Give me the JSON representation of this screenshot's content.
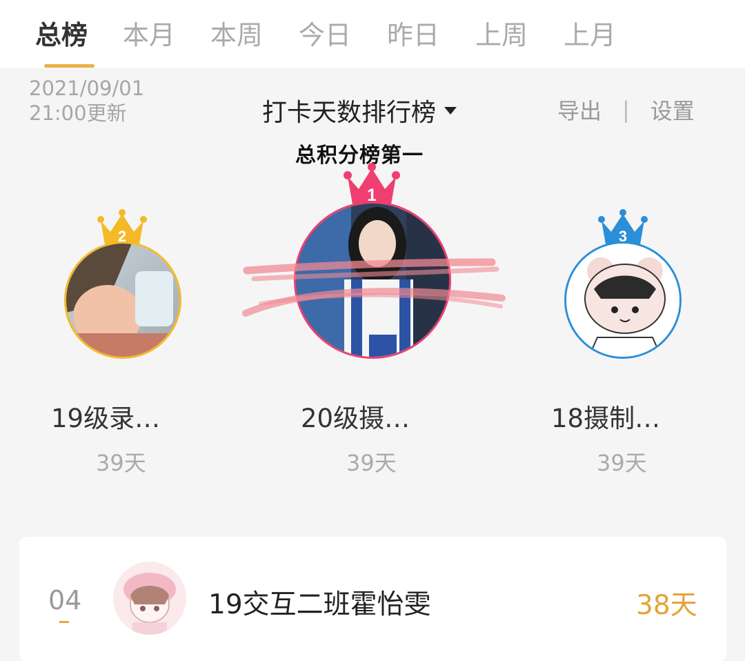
{
  "tabs": [
    {
      "label": "总榜",
      "active": true
    },
    {
      "label": "本月"
    },
    {
      "label": "本周"
    },
    {
      "label": "今日"
    },
    {
      "label": "昨日"
    },
    {
      "label": "上周"
    },
    {
      "label": "上月"
    }
  ],
  "update": {
    "date": "2021/09/01",
    "time": "21:00更新"
  },
  "board": {
    "title": "打卡天数排行榜"
  },
  "actions": {
    "export": "导出",
    "separator": "|",
    "settings": "设置"
  },
  "annotation": "总积分榜第一",
  "podium": [
    {
      "rank": "1",
      "name": "20级摄…",
      "days": "39天",
      "crown_color": "#ee3f70"
    },
    {
      "rank": "2",
      "name": "19级录…",
      "days": "39天",
      "crown_color": "#f5b928"
    },
    {
      "rank": "3",
      "name": "18摄制…",
      "days": "39天",
      "crown_color": "#2a8fd8"
    }
  ],
  "list": [
    {
      "rank": "04",
      "name": "19交互二班霍怡雯",
      "days": "38天"
    }
  ],
  "colors": {
    "accent": "#e9b244",
    "gold": "#f5b928",
    "pink": "#ee3f70",
    "blue": "#2a8fd8",
    "days_orange": "#e4a33a"
  }
}
